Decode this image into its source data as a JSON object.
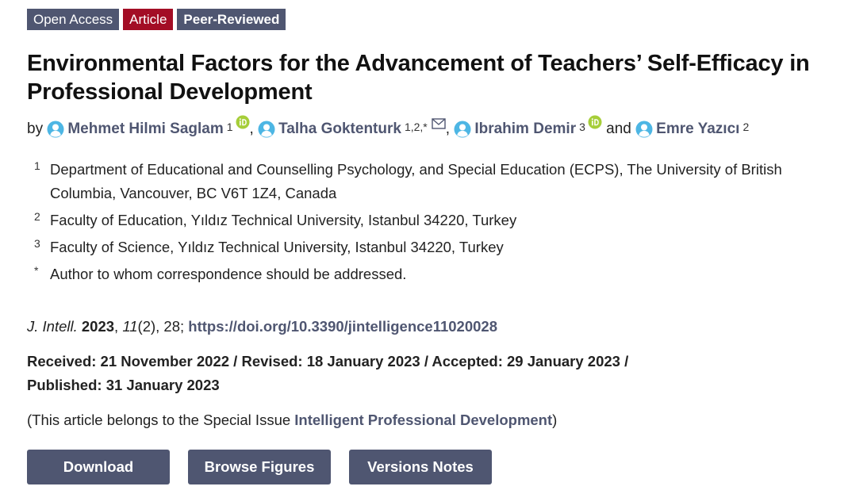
{
  "badges": {
    "open_access": "Open Access",
    "article": "Article",
    "peer_reviewed": "Peer-Reviewed"
  },
  "title": "Environmental Factors for the Advancement of Teachers’ Self-Efficacy in Professional Development",
  "authors": {
    "by": "by",
    "and": "and",
    "list": [
      {
        "name": "Mehmet Hilmi Saglam",
        "sup": "1"
      },
      {
        "name": "Talha Goktenturk",
        "sup": "1,2,*"
      },
      {
        "name": "Ibrahim Demir",
        "sup": "3"
      },
      {
        "name": "Emre Yazıcı",
        "sup": "2"
      }
    ]
  },
  "affiliations": [
    {
      "mark": "1",
      "text": "Department of Educational and Counselling Psychology, and Special Education (ECPS), The University of British Columbia, Vancouver, BC V6T 1Z4, Canada"
    },
    {
      "mark": "2",
      "text": "Faculty of Education, Yıldız Technical University, Istanbul 34220, Turkey"
    },
    {
      "mark": "3",
      "text": "Faculty of Science, Yıldız Technical University, Istanbul 34220, Turkey"
    },
    {
      "mark": "*",
      "text": "Author to whom correspondence should be addressed."
    }
  ],
  "citation": {
    "journal": "J. Intell.",
    "year": "2023",
    "volume": "11",
    "issue": "(2), 28; ",
    "doi": "https://doi.org/10.3390/jintelligence11020028"
  },
  "dates": {
    "line1": "Received: 21 November 2022 / Revised: 18 January 2023 / Accepted: 29 January 2023 /",
    "line2": "Published: 31 January 2023"
  },
  "special_issue": {
    "prefix": "(This article belongs to the Special Issue ",
    "link": "Intelligent Professional Development",
    "suffix": ")"
  },
  "buttons": {
    "download": "Download",
    "browse_figures": "Browse Figures",
    "versions_notes": "Versions Notes"
  },
  "colors": {
    "accent": "#4f5671",
    "article_badge": "#a30d25",
    "orcid": "#a6ce39",
    "person_icon": "#4db6e4"
  },
  "icons": {
    "person": "person-icon",
    "orcid": "orcid-icon",
    "mail": "mail-icon"
  }
}
